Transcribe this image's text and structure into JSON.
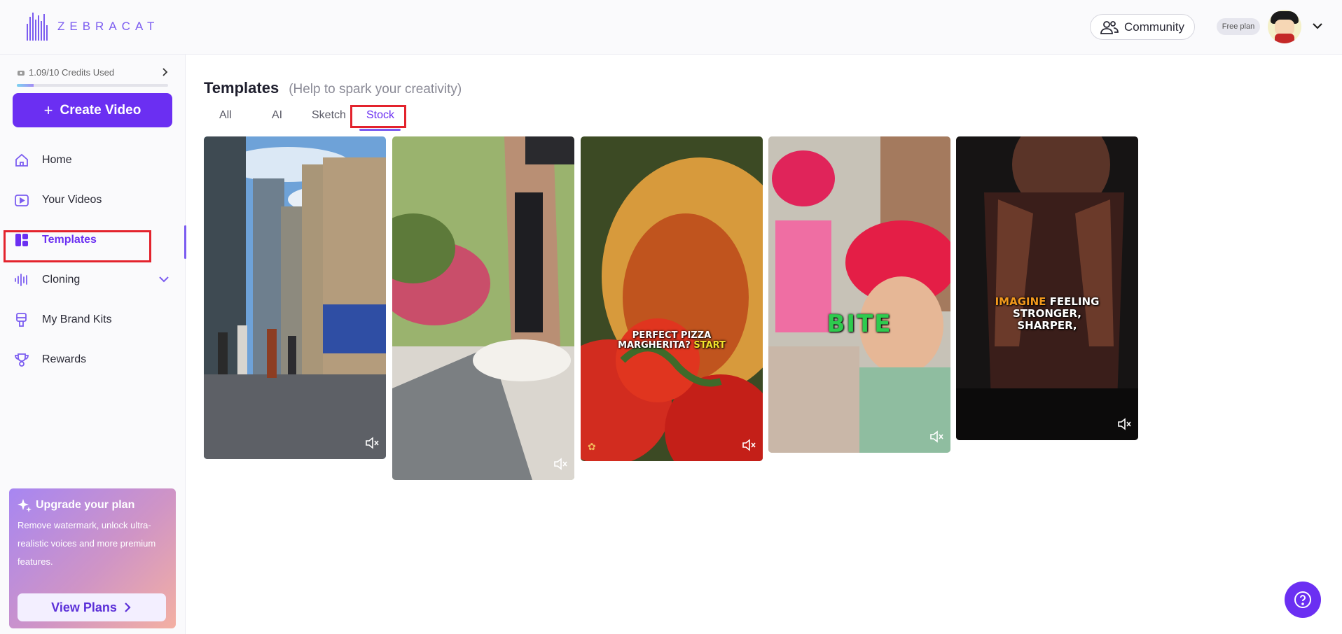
{
  "brand": {
    "name": "ZEBRACAT",
    "accent": "#6b2ff2"
  },
  "header": {
    "community_label": "Community",
    "plan_label": "Free plan"
  },
  "sidebar": {
    "credits_label": "1.09/10 Credits Used",
    "credits_fraction": 0.109,
    "create_label": "Create Video",
    "items": [
      {
        "label": "Home",
        "icon": "home-icon"
      },
      {
        "label": "Your Videos",
        "icon": "video-icon"
      },
      {
        "label": "Templates",
        "icon": "templates-icon",
        "active": true
      },
      {
        "label": "Cloning",
        "icon": "waveform-icon"
      },
      {
        "label": "My Brand Kits",
        "icon": "brand-kit-icon"
      },
      {
        "label": "Rewards",
        "icon": "trophy-icon"
      }
    ],
    "upgrade": {
      "title": "Upgrade your plan",
      "description": "Remove watermark, unlock ultra-realistic voices and more premium features.",
      "button_label": "View Plans"
    }
  },
  "main": {
    "title": "Templates",
    "subtitle": "(Help to spark your creativity)",
    "tabs": [
      {
        "label": "All"
      },
      {
        "label": "AI"
      },
      {
        "label": "Sketch"
      },
      {
        "label": "Stock",
        "active": true
      }
    ],
    "cards": [
      {
        "caption": []
      },
      {
        "caption": []
      },
      {
        "caption": [
          "PERFECT PIZZA",
          "MARGHERITA?",
          "START"
        ]
      },
      {
        "caption": [
          "BITE"
        ]
      },
      {
        "caption": [
          "IMAGINE",
          "FEELING",
          "STRONGER,",
          "SHARPER,"
        ]
      }
    ]
  }
}
